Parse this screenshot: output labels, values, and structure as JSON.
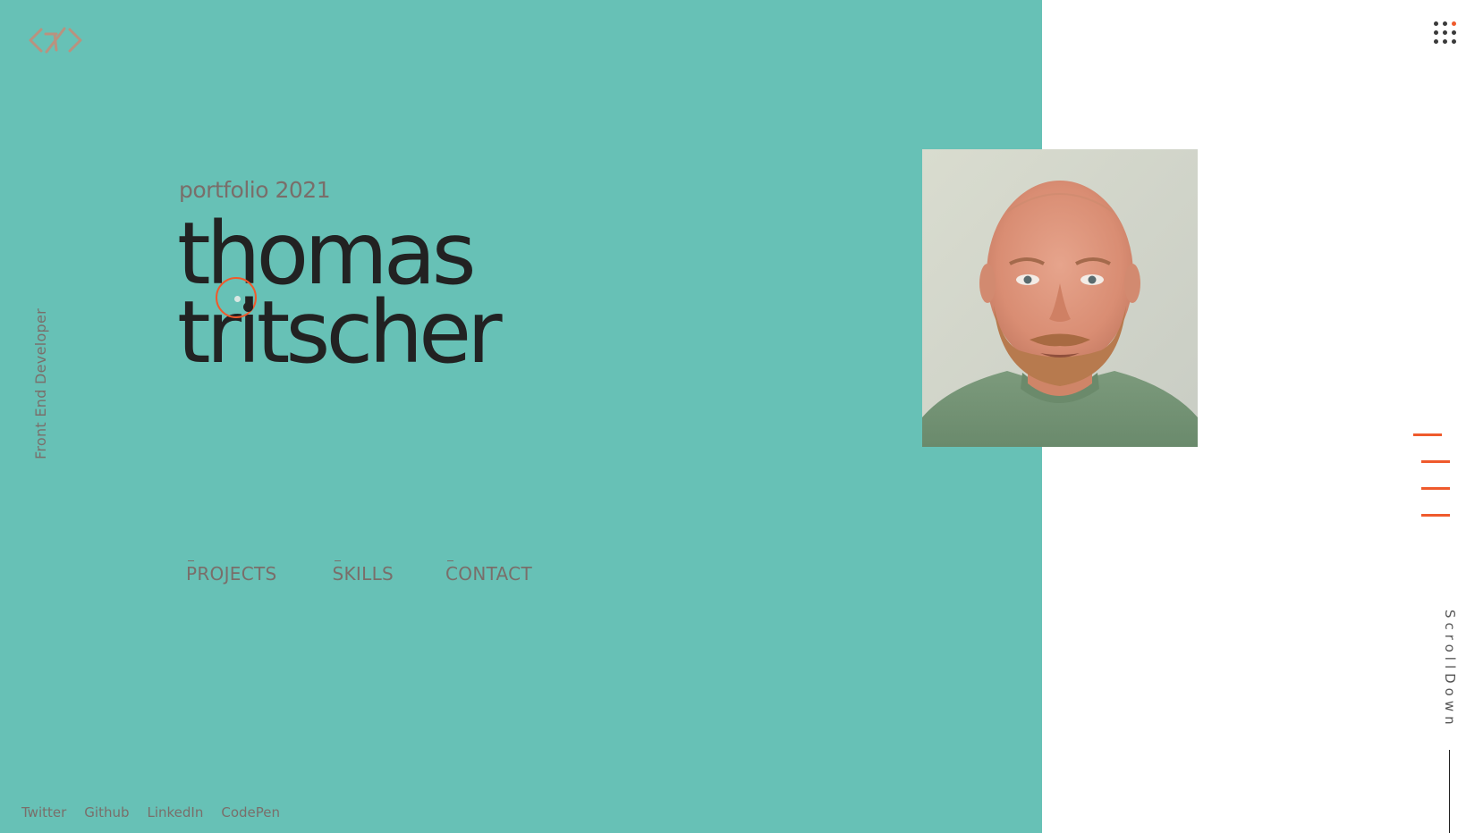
{
  "colors": {
    "teal": "#67c1b6",
    "accent": "#ef5a2c",
    "dark": "#222222",
    "muted": "#7a6e6a",
    "white": "#ffffff",
    "logo": "#b9927f"
  },
  "logo": {
    "icon": "code-brackets-tt-logo-icon"
  },
  "hero": {
    "tagline": "portfolio 2021",
    "first_name": "thomas",
    "last_name": "tritscher",
    "role": "Front End Developer"
  },
  "nav": {
    "projects": "PROJECTS",
    "skills": "SKILLS",
    "contact": "CONTACT"
  },
  "socials": {
    "twitter": "Twitter",
    "github": "Github",
    "linkedin": "LinkedIn",
    "codepen": "CodePen"
  },
  "portrait": {
    "icon": "profile-photo"
  },
  "menu": {
    "icon": "grid-menu-icon"
  },
  "section_indicator": {
    "count": 4,
    "active_index": 0
  },
  "scroll": {
    "label": "ScrollDown"
  }
}
